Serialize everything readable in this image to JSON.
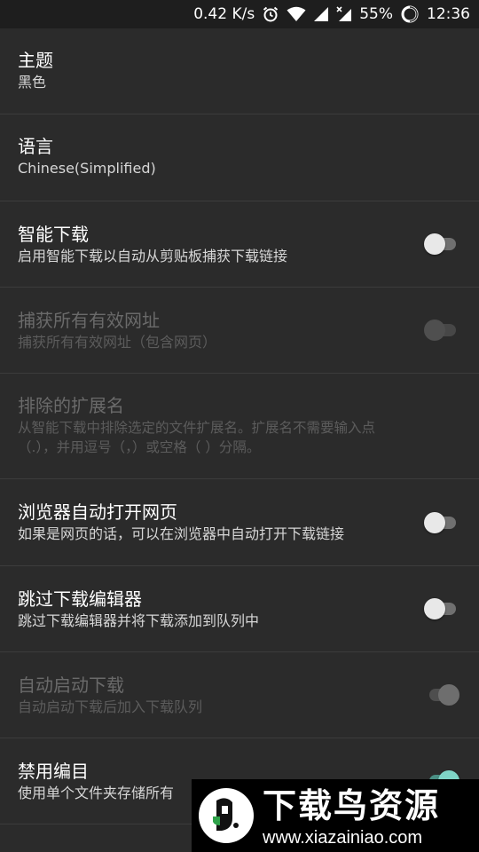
{
  "status_bar": {
    "speed": "0.42 K/s",
    "battery": "55%",
    "time": "12:36",
    "icons": [
      "alarm-icon",
      "wifi-icon",
      "signal-icon",
      "signal-x-icon",
      "battery-icon"
    ]
  },
  "settings": [
    {
      "title": "主题",
      "summary": "黑色"
    },
    {
      "title": "语言",
      "summary": "Chinese(Simplified)"
    },
    {
      "title": "智能下载",
      "summary": "启用智能下载以自动从剪贴板捕获下载链接",
      "toggle": "off"
    },
    {
      "title": "捕获所有有效网址",
      "summary": "捕获所有有效网址（包含网页）",
      "toggle": "off",
      "disabled": true
    },
    {
      "title": "排除的扩展名",
      "summary_lines": [
        "从智能下载中排除选定的文件扩展名。扩展名不需要输入点",
        "（.），并用逗号（，）或空格（ ）分隔。"
      ],
      "disabled": true
    },
    {
      "title": "浏览器自动打开网页",
      "summary": "如果是网页的话，可以在浏览器中自动打开下载链接",
      "toggle": "off"
    },
    {
      "title": "跳过下载编辑器",
      "summary": "跳过下载编辑器并将下载添加到队列中",
      "toggle": "off"
    },
    {
      "title": "自动启动下载",
      "summary": "自动启动下载后加入下载队列",
      "toggle": "on",
      "disabled": true
    },
    {
      "title": "禁用编目",
      "summary": "使用单个文件夹存储所有",
      "toggle": "on"
    }
  ],
  "watermark": {
    "title": "下载鸟资源",
    "url": "www.xiazainiao.com"
  },
  "colors": {
    "background": "#2b2b2b",
    "accent": "#7fd4c6"
  }
}
